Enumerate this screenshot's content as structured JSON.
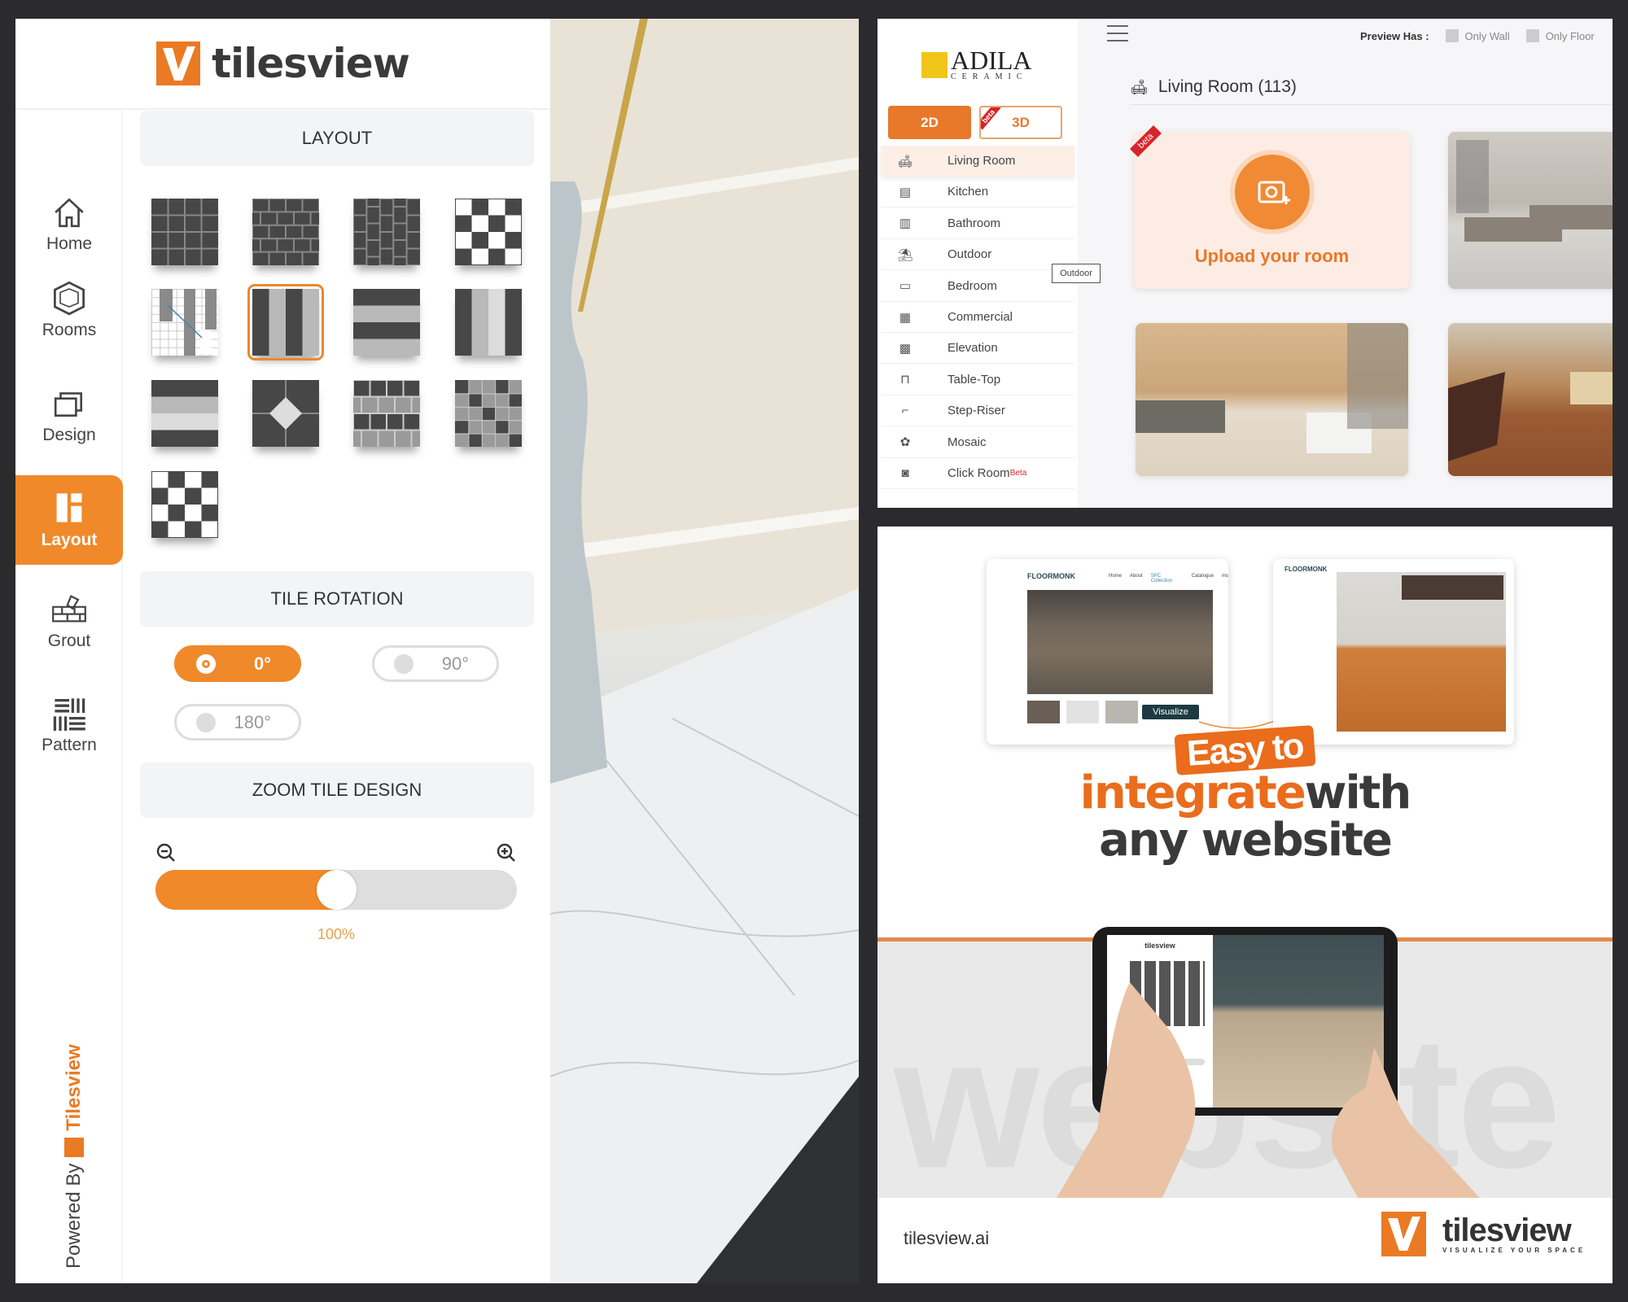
{
  "left_app": {
    "brand": "tilesview",
    "nav": [
      {
        "label": "Home",
        "icon": "home-icon"
      },
      {
        "label": "Rooms",
        "icon": "rooms-icon"
      },
      {
        "label": "Design",
        "icon": "design-icon"
      },
      {
        "label": "Layout",
        "icon": "layout-icon",
        "active": true
      },
      {
        "label": "Grout",
        "icon": "grout-icon"
      },
      {
        "label": "Pattern",
        "icon": "pattern-icon"
      }
    ],
    "layout_title": "LAYOUT",
    "layouts": [
      "grid",
      "brick",
      "vertical-brick",
      "checker-bordered",
      "herringbone",
      "vertical-stripes",
      "horizontal-stripes",
      "vertical-stripes-3",
      "horizontal-stripes-3",
      "diamond",
      "alternating-brick",
      "mixed-checker",
      "checker-bordered"
    ],
    "selected_layout": 5,
    "rotation_title": "TILE ROTATION",
    "rotations": [
      {
        "label": "0°",
        "selected": true
      },
      {
        "label": "90°"
      },
      {
        "label": "180°"
      }
    ],
    "zoom_title": "ZOOM TILE DESIGN",
    "zoom_value": "100%",
    "zoom_fraction": 0.5,
    "powered_by": "Powered By",
    "powered_brand": "Tilesview",
    "accent": "#f0892a"
  },
  "right_app": {
    "logo_name": "ADILA",
    "logo_sub": "CERAMIC",
    "mode_2d": "2D",
    "mode_3d": "3D",
    "beta": "beta",
    "preview_label": "Preview Has :",
    "only_wall": "Only Wall",
    "only_floor": "Only Floor",
    "menu": [
      {
        "label": "Living Room",
        "icon": "sofa-icon"
      },
      {
        "label": "Kitchen",
        "icon": "kitchen-icon"
      },
      {
        "label": "Bathroom",
        "icon": "bathroom-icon"
      },
      {
        "label": "Outdoor",
        "icon": "outdoor-icon"
      },
      {
        "label": "Bedroom",
        "icon": "bed-icon"
      },
      {
        "label": "Commercial",
        "icon": "building-icon"
      },
      {
        "label": "Elevation",
        "icon": "elevation-icon"
      },
      {
        "label": "Table-Top",
        "icon": "table-icon"
      },
      {
        "label": "Step-Riser",
        "icon": "stairs-icon"
      },
      {
        "label": "Mosaic",
        "icon": "mosaic-icon"
      },
      {
        "label": "Click Room",
        "icon": "camera-icon",
        "sup": "Beta"
      }
    ],
    "tooltip": "Outdoor",
    "section_title": "Living Room (113)",
    "upload_label": "Upload your room"
  },
  "promo": {
    "mini_brand": "FLOORMONK",
    "mini_nav": [
      "Home",
      "About",
      "SPC Collection",
      "Catalogue",
      "Ins"
    ],
    "visualize": "Visualize",
    "headline_badge": "Easy to",
    "headline_orange": "integrate",
    "headline_dark1": "with",
    "headline_dark2": "any website",
    "watermark": "website",
    "tablet_brand": "tilesview",
    "footer_url": "tilesview.ai",
    "footer_brand": "tilesview",
    "footer_tagline": "VISUALIZE YOUR SPACE"
  }
}
